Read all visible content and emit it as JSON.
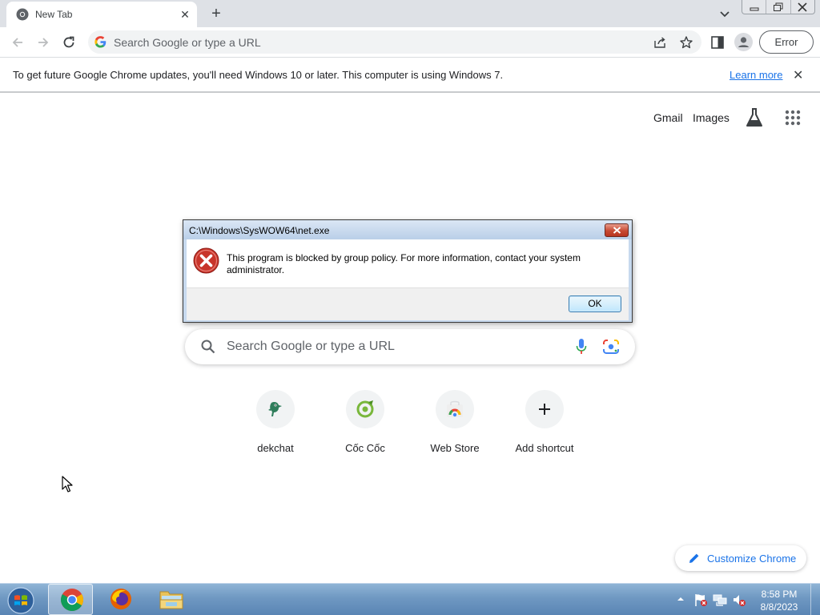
{
  "browser": {
    "tab": {
      "title": "New Tab",
      "close_glyph": "✕"
    },
    "new_tab_glyph": "+",
    "omnibox": {
      "placeholder": "Search Google or type a URL"
    },
    "error_button": "Error"
  },
  "infobar": {
    "message": "To get future Google Chrome updates, you'll need Windows 10 or later. This computer is using Windows 7.",
    "link": "Learn more",
    "close_glyph": "✕"
  },
  "ntp": {
    "top_links": {
      "gmail": "Gmail",
      "images": "Images"
    },
    "search": {
      "placeholder": "Search Google or type a URL"
    },
    "shortcuts": [
      {
        "label": "dekchat",
        "icon": "dekchat-icon"
      },
      {
        "label": "Cốc Cốc",
        "icon": "coccoc-icon"
      },
      {
        "label": "Web Store",
        "icon": "webstore-icon"
      },
      {
        "label": "Add shortcut",
        "icon": "plus-icon"
      }
    ],
    "customize": "Customize Chrome"
  },
  "dialog": {
    "title": "C:\\Windows\\SysWOW64\\net.exe",
    "message": "This program is blocked by group policy. For more information, contact your system administrator.",
    "ok": "OK"
  },
  "taskbar": {
    "clock": {
      "time": "8:58 PM",
      "date": "8/8/2023"
    }
  },
  "colors": {
    "accent": "#1a73e8",
    "tabstrip": "#dee1e6",
    "error_red": "#c8342a",
    "taskbar": "#6f98c2"
  }
}
